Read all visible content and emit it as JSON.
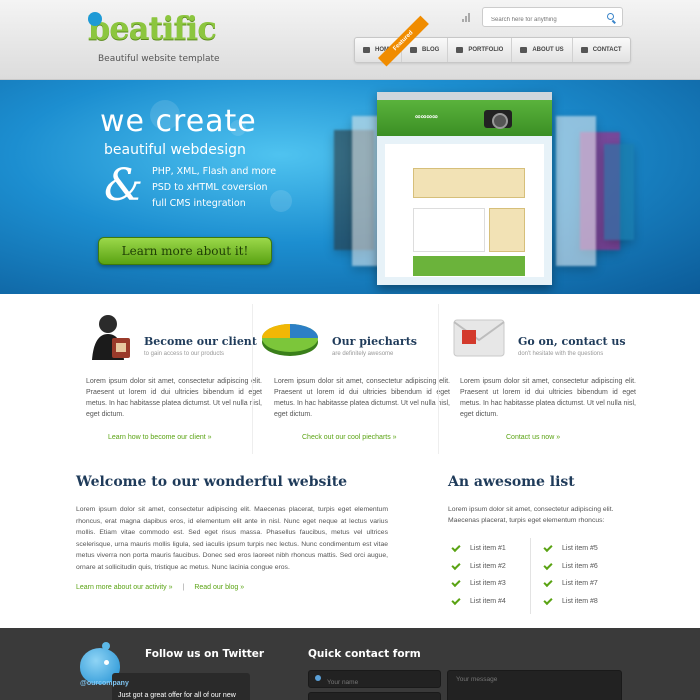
{
  "header": {
    "logo": "beatific",
    "tagline": "Beautiful website template",
    "search_placeholder": "Search here for anything",
    "nav": [
      {
        "label": "HOME",
        "icon": "home-icon"
      },
      {
        "label": "BLOG",
        "icon": "chat-icon"
      },
      {
        "label": "PORTFOLIO",
        "icon": "portfolio-icon"
      },
      {
        "label": "ABOUT US",
        "icon": "book-icon"
      },
      {
        "label": "CONTACT",
        "icon": "mail-icon"
      }
    ]
  },
  "hero": {
    "title": "we create",
    "subtitle": "beautiful webdesign",
    "amp": "&",
    "lines": [
      "PHP, XML, Flash and more",
      "PSD to xHTML coversion",
      "full CMS integration"
    ],
    "button": "Learn more about it!",
    "featured_badge": "Featured"
  },
  "features": [
    {
      "title": "Become our client",
      "subtitle": "to gain access to our products",
      "text": "Lorem ipsum dolor sit amet, consectetur adipiscing elit. Praesent ut lorem id dui ultricies bibendum id eget metus. In hac habitasse platea dictumst. Ut vel nulla nisl, eget dictum.",
      "link": "Learn how to become our client »",
      "icon": "client-icon"
    },
    {
      "title": "Our piecharts",
      "subtitle": "are definitely awesome",
      "text": "Lorem ipsum dolor sit amet, consectetur adipiscing elit. Praesent ut lorem id dui ultricies bibendum id eget metus. In hac habitasse platea dictumst. Ut vel nulla nisl, eget dictum.",
      "link": "Check out our cool piecharts »",
      "icon": "piechart-icon"
    },
    {
      "title": "Go on, contact us",
      "subtitle": "don't hesitate with the questions",
      "text": "Lorem ipsum dolor sit amet, consectetur adipiscing elit. Praesent ut lorem id dui ultricies bibendum id eget metus. In hac habitasse platea dictumst. Ut vel nulla nisl, eget dictum.",
      "link": "Contact us now »",
      "icon": "envelope-icon"
    }
  ],
  "welcome": {
    "title": "Welcome to our wonderful website",
    "text": "Lorem ipsum dolor sit amet, consectetur adipiscing elit. Maecenas placerat, turpis eget elementum rhoncus, erat magna dapibus eros, id elementum elit ante in nisl. Nunc eget neque at lectus varius mollis. Etiam vitae commodo est. Sed eget risus massa. Phasellus faucibus, metus vel ultrices scelerisque, urna mauris mollis ligula, sed iaculis ipsum turpis nec lectus. Nunc condimentum est vitae metus viverra non porta mauris faucibus. Donec sed eros laoreet nibh rhoncus mattis. Sed orci augue, ornare at sollicitudin quis, tristique ac metus. Nunc lacinia congue eros.",
    "link1": "Learn more about our activity »",
    "separator": "|",
    "link2": "Read our blog »"
  },
  "list": {
    "title": "An awesome list",
    "intro": "Lorem ipsum dolor sit amet, consectetur adipiscing elit. Maecenas placerat, turpis eget elementum rhoncus:",
    "col1": [
      "List item #1",
      "List item #2",
      "List item #3",
      "List item #4"
    ],
    "col2": [
      "List item #5",
      "List item #6",
      "List item #7",
      "List item #8"
    ]
  },
  "footer": {
    "twitter_title": "Follow us on Twitter",
    "handle": "@ourcompany",
    "tweet": "Just got a great offer for all of our new",
    "contact_title": "Quick contact form",
    "name_placeholder": "Your name",
    "message_placeholder": "Your message"
  }
}
